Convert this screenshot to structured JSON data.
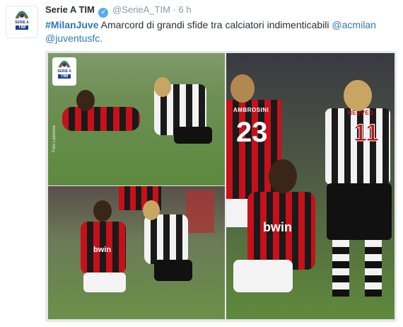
{
  "tweet": {
    "display_name": "Serie A TIM",
    "handle": "@SerieA_TIM",
    "separator": "·",
    "time": "6 h",
    "hashtag": "#MilanJuve",
    "body": "Amarcord di grandi sfide tra calciatori indimenticabili",
    "mention_1": "@acmilan",
    "mention_2": "@juventusfc",
    "period": "."
  },
  "media": {
    "logo_text": "SERIE A",
    "logo_tim": "TIM",
    "jersey_number_1": "23",
    "jersey_number_2": "11",
    "name_plate_1": "AMBROSINI",
    "name_plate_2": "NEDVED",
    "sponsor": "bwin",
    "credit": "Foto Lasresse"
  },
  "avatar": {
    "logo_text": "SERIE A",
    "logo_tim": "TIM"
  }
}
